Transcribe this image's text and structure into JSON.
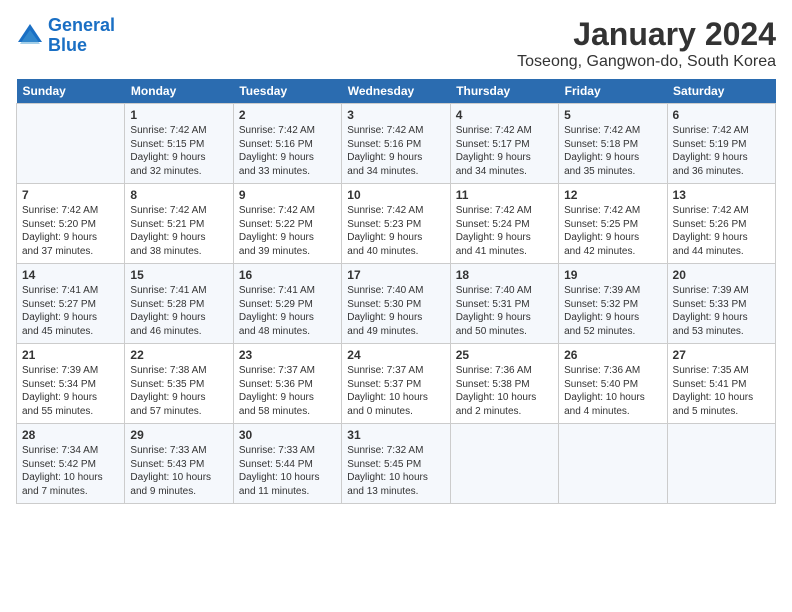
{
  "header": {
    "logo_line1": "General",
    "logo_line2": "Blue",
    "month_title": "January 2024",
    "location": "Toseong, Gangwon-do, South Korea"
  },
  "days_of_week": [
    "Sunday",
    "Monday",
    "Tuesday",
    "Wednesday",
    "Thursday",
    "Friday",
    "Saturday"
  ],
  "weeks": [
    [
      {
        "day": "",
        "info": ""
      },
      {
        "day": "1",
        "info": "Sunrise: 7:42 AM\nSunset: 5:15 PM\nDaylight: 9 hours\nand 32 minutes."
      },
      {
        "day": "2",
        "info": "Sunrise: 7:42 AM\nSunset: 5:16 PM\nDaylight: 9 hours\nand 33 minutes."
      },
      {
        "day": "3",
        "info": "Sunrise: 7:42 AM\nSunset: 5:16 PM\nDaylight: 9 hours\nand 34 minutes."
      },
      {
        "day": "4",
        "info": "Sunrise: 7:42 AM\nSunset: 5:17 PM\nDaylight: 9 hours\nand 34 minutes."
      },
      {
        "day": "5",
        "info": "Sunrise: 7:42 AM\nSunset: 5:18 PM\nDaylight: 9 hours\nand 35 minutes."
      },
      {
        "day": "6",
        "info": "Sunrise: 7:42 AM\nSunset: 5:19 PM\nDaylight: 9 hours\nand 36 minutes."
      }
    ],
    [
      {
        "day": "7",
        "info": "Sunrise: 7:42 AM\nSunset: 5:20 PM\nDaylight: 9 hours\nand 37 minutes."
      },
      {
        "day": "8",
        "info": "Sunrise: 7:42 AM\nSunset: 5:21 PM\nDaylight: 9 hours\nand 38 minutes."
      },
      {
        "day": "9",
        "info": "Sunrise: 7:42 AM\nSunset: 5:22 PM\nDaylight: 9 hours\nand 39 minutes."
      },
      {
        "day": "10",
        "info": "Sunrise: 7:42 AM\nSunset: 5:23 PM\nDaylight: 9 hours\nand 40 minutes."
      },
      {
        "day": "11",
        "info": "Sunrise: 7:42 AM\nSunset: 5:24 PM\nDaylight: 9 hours\nand 41 minutes."
      },
      {
        "day": "12",
        "info": "Sunrise: 7:42 AM\nSunset: 5:25 PM\nDaylight: 9 hours\nand 42 minutes."
      },
      {
        "day": "13",
        "info": "Sunrise: 7:42 AM\nSunset: 5:26 PM\nDaylight: 9 hours\nand 44 minutes."
      }
    ],
    [
      {
        "day": "14",
        "info": "Sunrise: 7:41 AM\nSunset: 5:27 PM\nDaylight: 9 hours\nand 45 minutes."
      },
      {
        "day": "15",
        "info": "Sunrise: 7:41 AM\nSunset: 5:28 PM\nDaylight: 9 hours\nand 46 minutes."
      },
      {
        "day": "16",
        "info": "Sunrise: 7:41 AM\nSunset: 5:29 PM\nDaylight: 9 hours\nand 48 minutes."
      },
      {
        "day": "17",
        "info": "Sunrise: 7:40 AM\nSunset: 5:30 PM\nDaylight: 9 hours\nand 49 minutes."
      },
      {
        "day": "18",
        "info": "Sunrise: 7:40 AM\nSunset: 5:31 PM\nDaylight: 9 hours\nand 50 minutes."
      },
      {
        "day": "19",
        "info": "Sunrise: 7:39 AM\nSunset: 5:32 PM\nDaylight: 9 hours\nand 52 minutes."
      },
      {
        "day": "20",
        "info": "Sunrise: 7:39 AM\nSunset: 5:33 PM\nDaylight: 9 hours\nand 53 minutes."
      }
    ],
    [
      {
        "day": "21",
        "info": "Sunrise: 7:39 AM\nSunset: 5:34 PM\nDaylight: 9 hours\nand 55 minutes."
      },
      {
        "day": "22",
        "info": "Sunrise: 7:38 AM\nSunset: 5:35 PM\nDaylight: 9 hours\nand 57 minutes."
      },
      {
        "day": "23",
        "info": "Sunrise: 7:37 AM\nSunset: 5:36 PM\nDaylight: 9 hours\nand 58 minutes."
      },
      {
        "day": "24",
        "info": "Sunrise: 7:37 AM\nSunset: 5:37 PM\nDaylight: 10 hours\nand 0 minutes."
      },
      {
        "day": "25",
        "info": "Sunrise: 7:36 AM\nSunset: 5:38 PM\nDaylight: 10 hours\nand 2 minutes."
      },
      {
        "day": "26",
        "info": "Sunrise: 7:36 AM\nSunset: 5:40 PM\nDaylight: 10 hours\nand 4 minutes."
      },
      {
        "day": "27",
        "info": "Sunrise: 7:35 AM\nSunset: 5:41 PM\nDaylight: 10 hours\nand 5 minutes."
      }
    ],
    [
      {
        "day": "28",
        "info": "Sunrise: 7:34 AM\nSunset: 5:42 PM\nDaylight: 10 hours\nand 7 minutes."
      },
      {
        "day": "29",
        "info": "Sunrise: 7:33 AM\nSunset: 5:43 PM\nDaylight: 10 hours\nand 9 minutes."
      },
      {
        "day": "30",
        "info": "Sunrise: 7:33 AM\nSunset: 5:44 PM\nDaylight: 10 hours\nand 11 minutes."
      },
      {
        "day": "31",
        "info": "Sunrise: 7:32 AM\nSunset: 5:45 PM\nDaylight: 10 hours\nand 13 minutes."
      },
      {
        "day": "",
        "info": ""
      },
      {
        "day": "",
        "info": ""
      },
      {
        "day": "",
        "info": ""
      }
    ]
  ]
}
